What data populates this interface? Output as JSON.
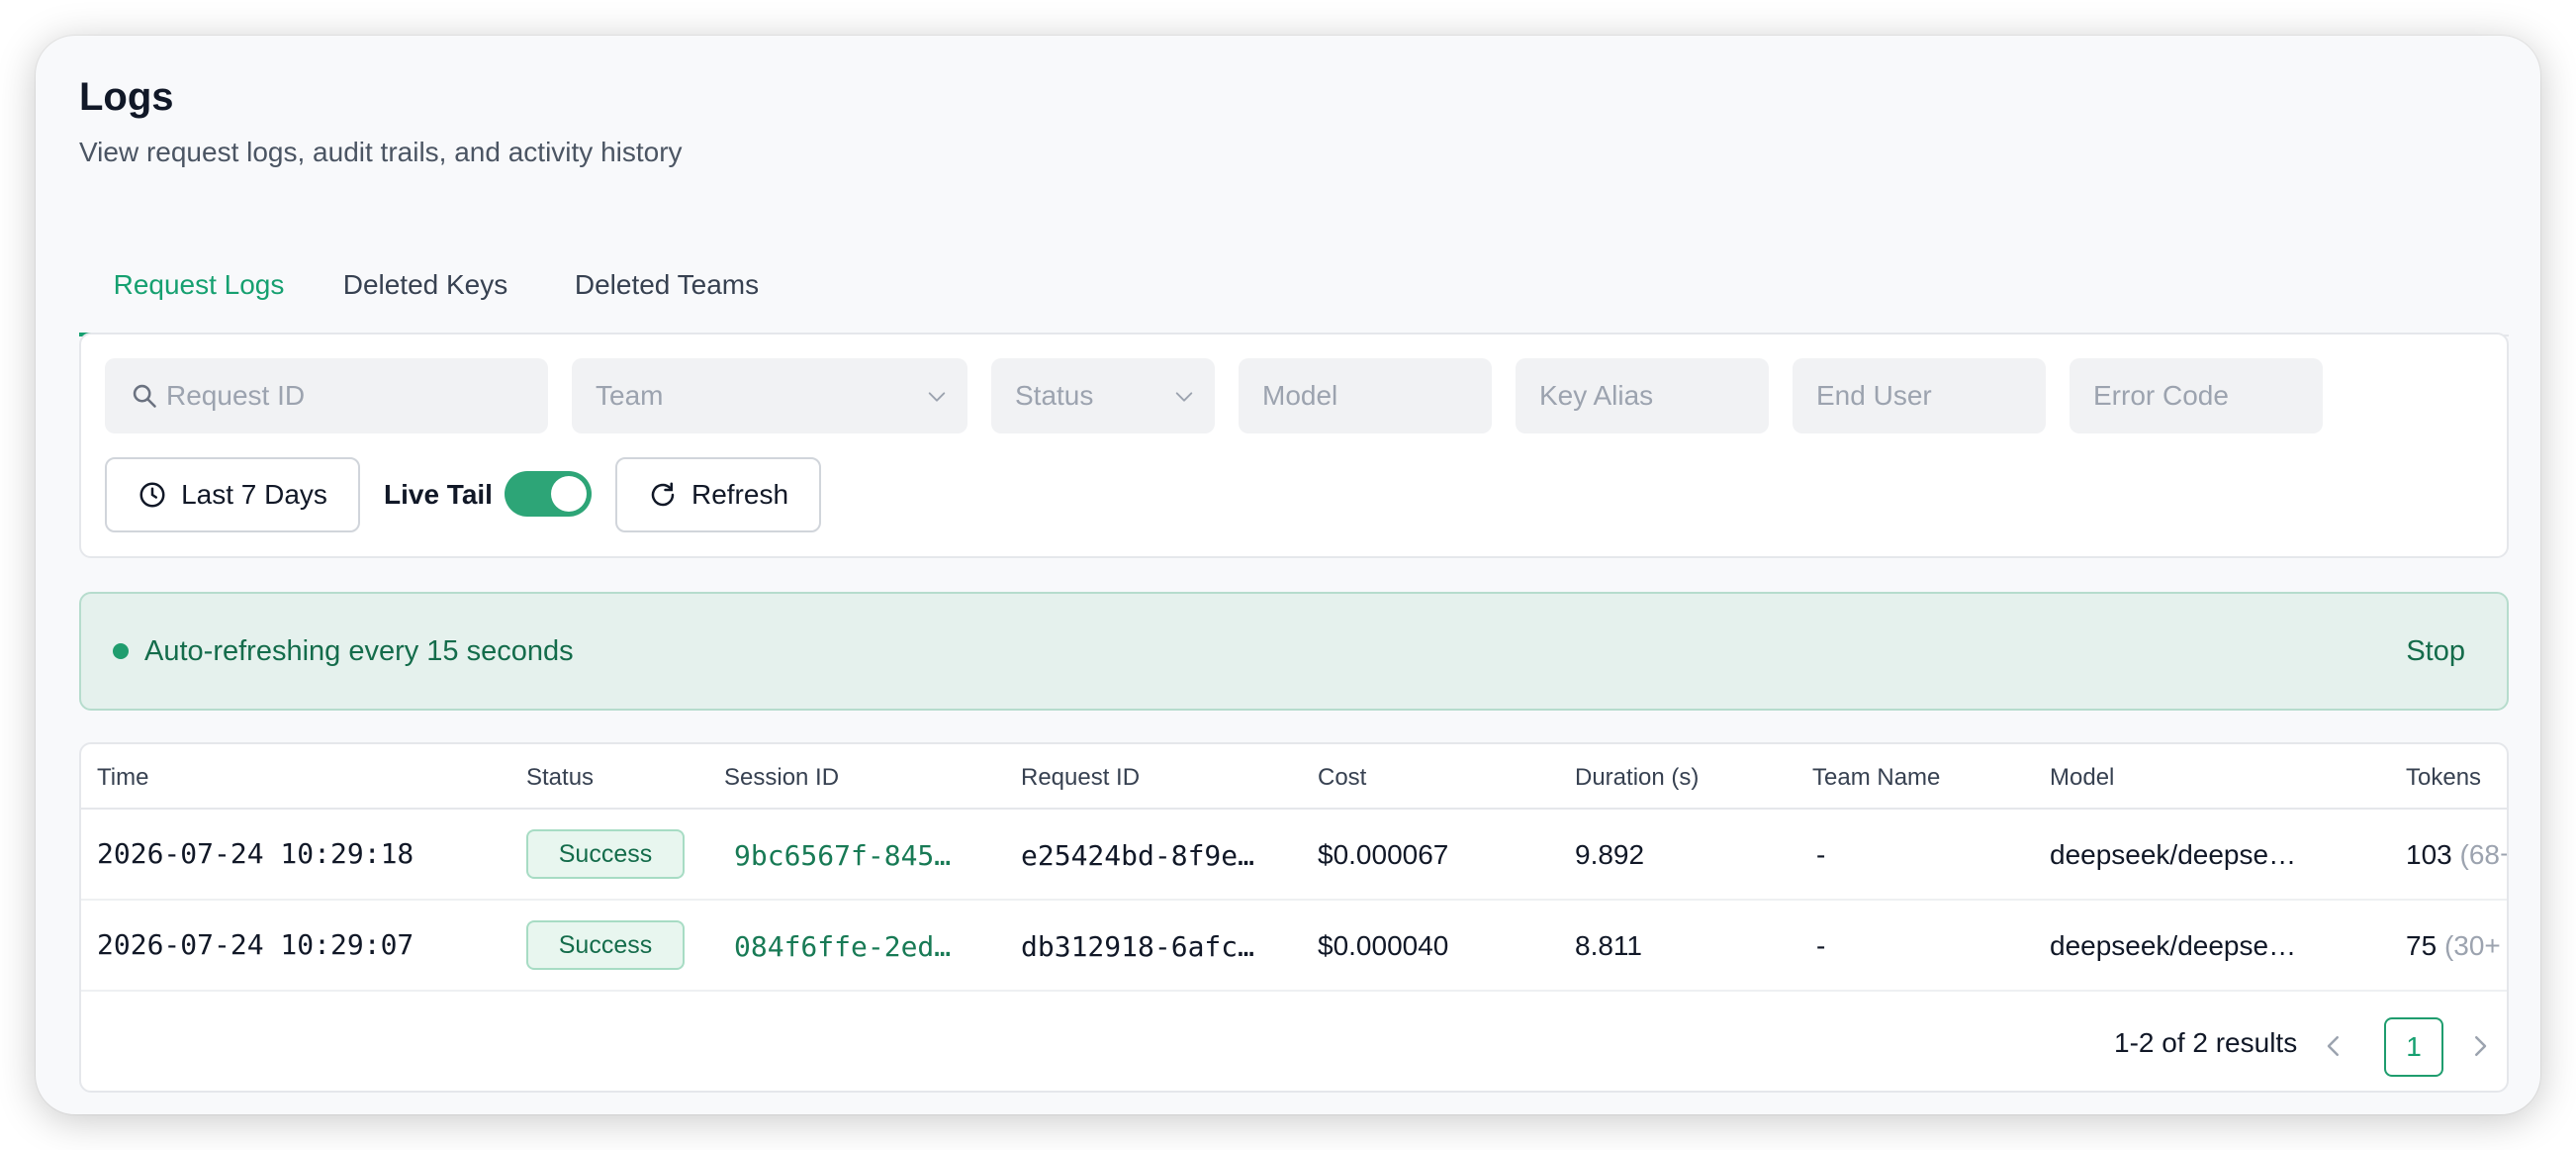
{
  "header": {
    "title": "Logs",
    "subtitle": "View request logs, audit trails, and activity history"
  },
  "tabs": [
    {
      "label": "Request Logs",
      "active": true
    },
    {
      "label": "Deleted Keys",
      "active": false
    },
    {
      "label": "Deleted Teams",
      "active": false
    }
  ],
  "filters": {
    "request_id_placeholder": "Request ID",
    "team_placeholder": "Team",
    "status_placeholder": "Status",
    "model_placeholder": "Model",
    "key_alias_placeholder": "Key Alias",
    "end_user_placeholder": "End User",
    "error_code_placeholder": "Error Code",
    "time_range_label": "Last 7 Days",
    "live_tail_label": "Live Tail",
    "live_tail_on": true,
    "refresh_label": "Refresh"
  },
  "banner": {
    "message": "Auto-refreshing every 15 seconds",
    "stop_label": "Stop"
  },
  "table": {
    "columns": [
      "Time",
      "Status",
      "Session ID",
      "Request ID",
      "Cost",
      "Duration (s)",
      "Team Name",
      "Model",
      "Tokens"
    ],
    "rows": [
      {
        "time": "2026-07-24 10:29:18",
        "status": "Success",
        "session_id": "9bc6567f-845…",
        "request_id": "e25424bd-8f9e…",
        "cost": "$0.000067",
        "duration": "9.892",
        "team": "-",
        "model": "deepseek/deepse…",
        "tokens": "103",
        "tokens_extra": "(68+"
      },
      {
        "time": "2026-07-24 10:29:07",
        "status": "Success",
        "session_id": "084f6ffe-2ed…",
        "request_id": "db312918-6afc…",
        "cost": "$0.000040",
        "duration": "8.811",
        "team": "-",
        "model": "deepseek/deepse…",
        "tokens": "75",
        "tokens_extra": "(30+"
      }
    ]
  },
  "pagination": {
    "summary": "1-2 of 2 results",
    "current_page": "1"
  },
  "colors": {
    "accent": "#16a070",
    "banner_bg": "#e5f1ed",
    "success_text": "#146c4b"
  }
}
